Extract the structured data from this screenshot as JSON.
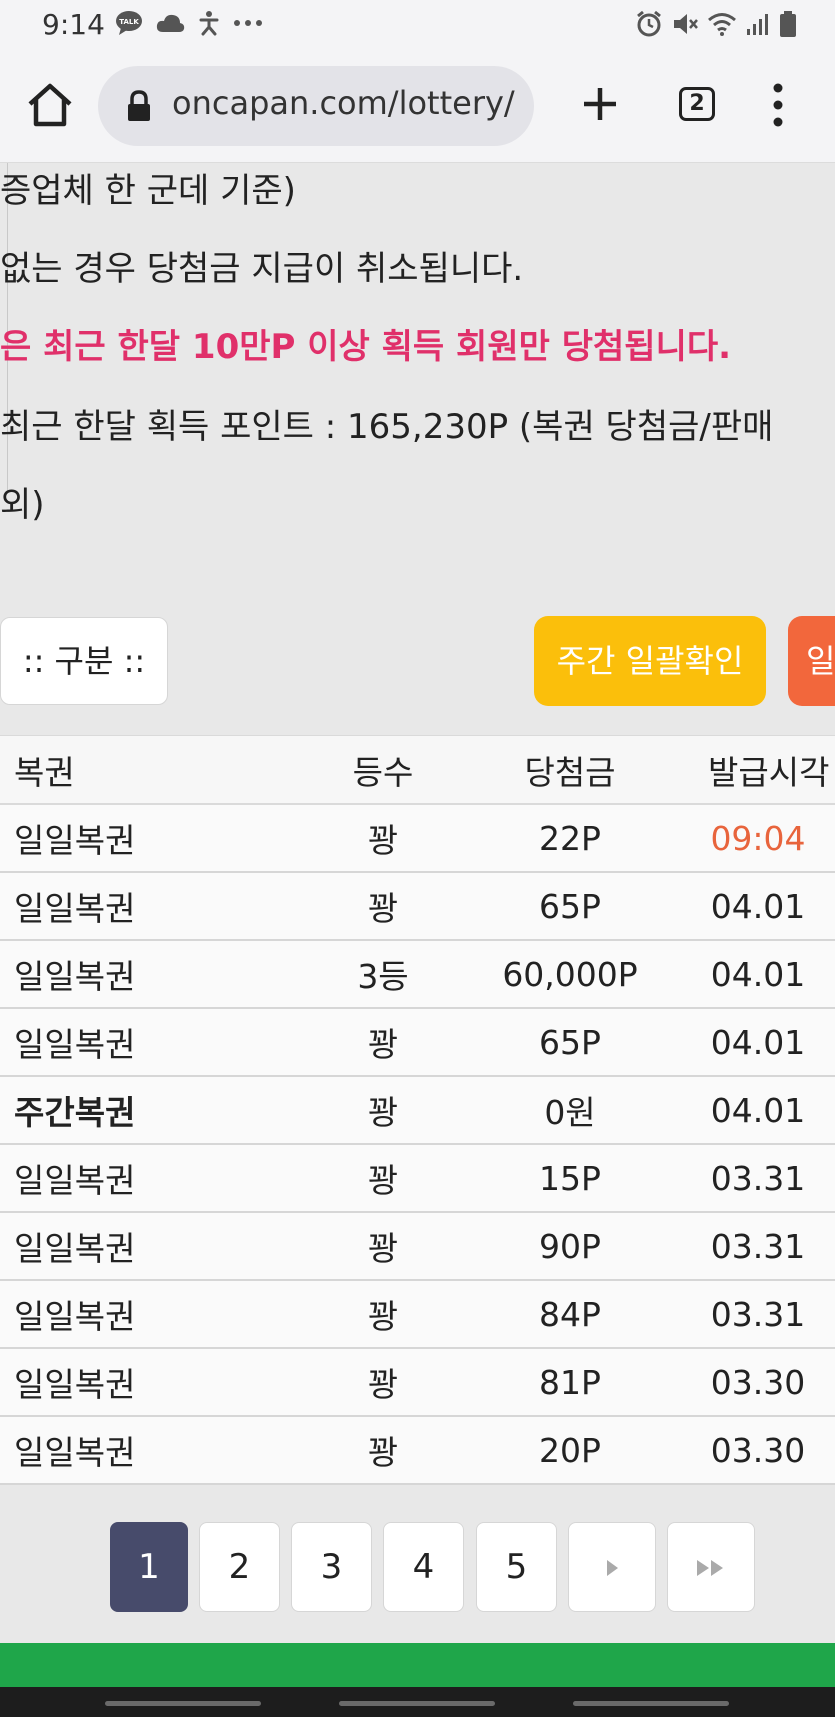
{
  "status_bar": {
    "time": "9:14",
    "left_icons": [
      "talk-icon",
      "cloud-icon",
      "accessibility-icon",
      "more-dots-icon"
    ],
    "right_icons": [
      "alarm-icon",
      "mute-icon",
      "wifi-icon",
      "signal-icon",
      "battery-icon"
    ]
  },
  "browser": {
    "url": "oncapan.com/lottery/",
    "tab_count": "2"
  },
  "notices": {
    "line1": "증업체 한 군데 기준)",
    "line2": " 없는 경우 당첨금 지급이 취소됩니다.",
    "line3": "은 최근 한달 10만P 이상 획득 회원만 당첨됩니다.",
    "line4": " 최근 한달 획득 포인트 : 165,230P (복권 당첨금/판매",
    "line5": "외)"
  },
  "controls": {
    "category_select": ":: 구분 ::",
    "weekly_check_button": "주간 일괄확인",
    "daily_check_button": "일"
  },
  "table": {
    "headers": {
      "lottery": "복권",
      "rank": "등수",
      "prize": "당첨금",
      "issued_time": "발급시각"
    },
    "rows": [
      {
        "lottery": "일일복권",
        "rank": "꽝",
        "prize": "22P",
        "time": "09:04"
      },
      {
        "lottery": "일일복권",
        "rank": "꽝",
        "prize": "65P",
        "time": "04.01"
      },
      {
        "lottery": "일일복권",
        "rank": "3등",
        "prize": "60,000P",
        "time": "04.01"
      },
      {
        "lottery": "일일복권",
        "rank": "꽝",
        "prize": "65P",
        "time": "04.01"
      },
      {
        "lottery": "주간복권",
        "rank": "꽝",
        "prize": "0원",
        "time": "04.01"
      },
      {
        "lottery": "일일복권",
        "rank": "꽝",
        "prize": "15P",
        "time": "03.31"
      },
      {
        "lottery": "일일복권",
        "rank": "꽝",
        "prize": "90P",
        "time": "03.31"
      },
      {
        "lottery": "일일복권",
        "rank": "꽝",
        "prize": "84P",
        "time": "03.31"
      },
      {
        "lottery": "일일복권",
        "rank": "꽝",
        "prize": "81P",
        "time": "03.30"
      },
      {
        "lottery": "일일복권",
        "rank": "꽝",
        "prize": "20P",
        "time": "03.30"
      }
    ]
  },
  "pagination": {
    "pages": [
      "1",
      "2",
      "3",
      "4",
      "5"
    ],
    "current_page": "1",
    "next_icon": "next-page-icon",
    "last_icon": "last-page-icon"
  },
  "colors": {
    "accent_red": "#e0306a",
    "weekly_button": "#fbbf0b",
    "daily_button": "#f2673c",
    "highlight_time": "#e8643c",
    "active_page": "#474b6b",
    "footer_green": "#1fa64a"
  }
}
